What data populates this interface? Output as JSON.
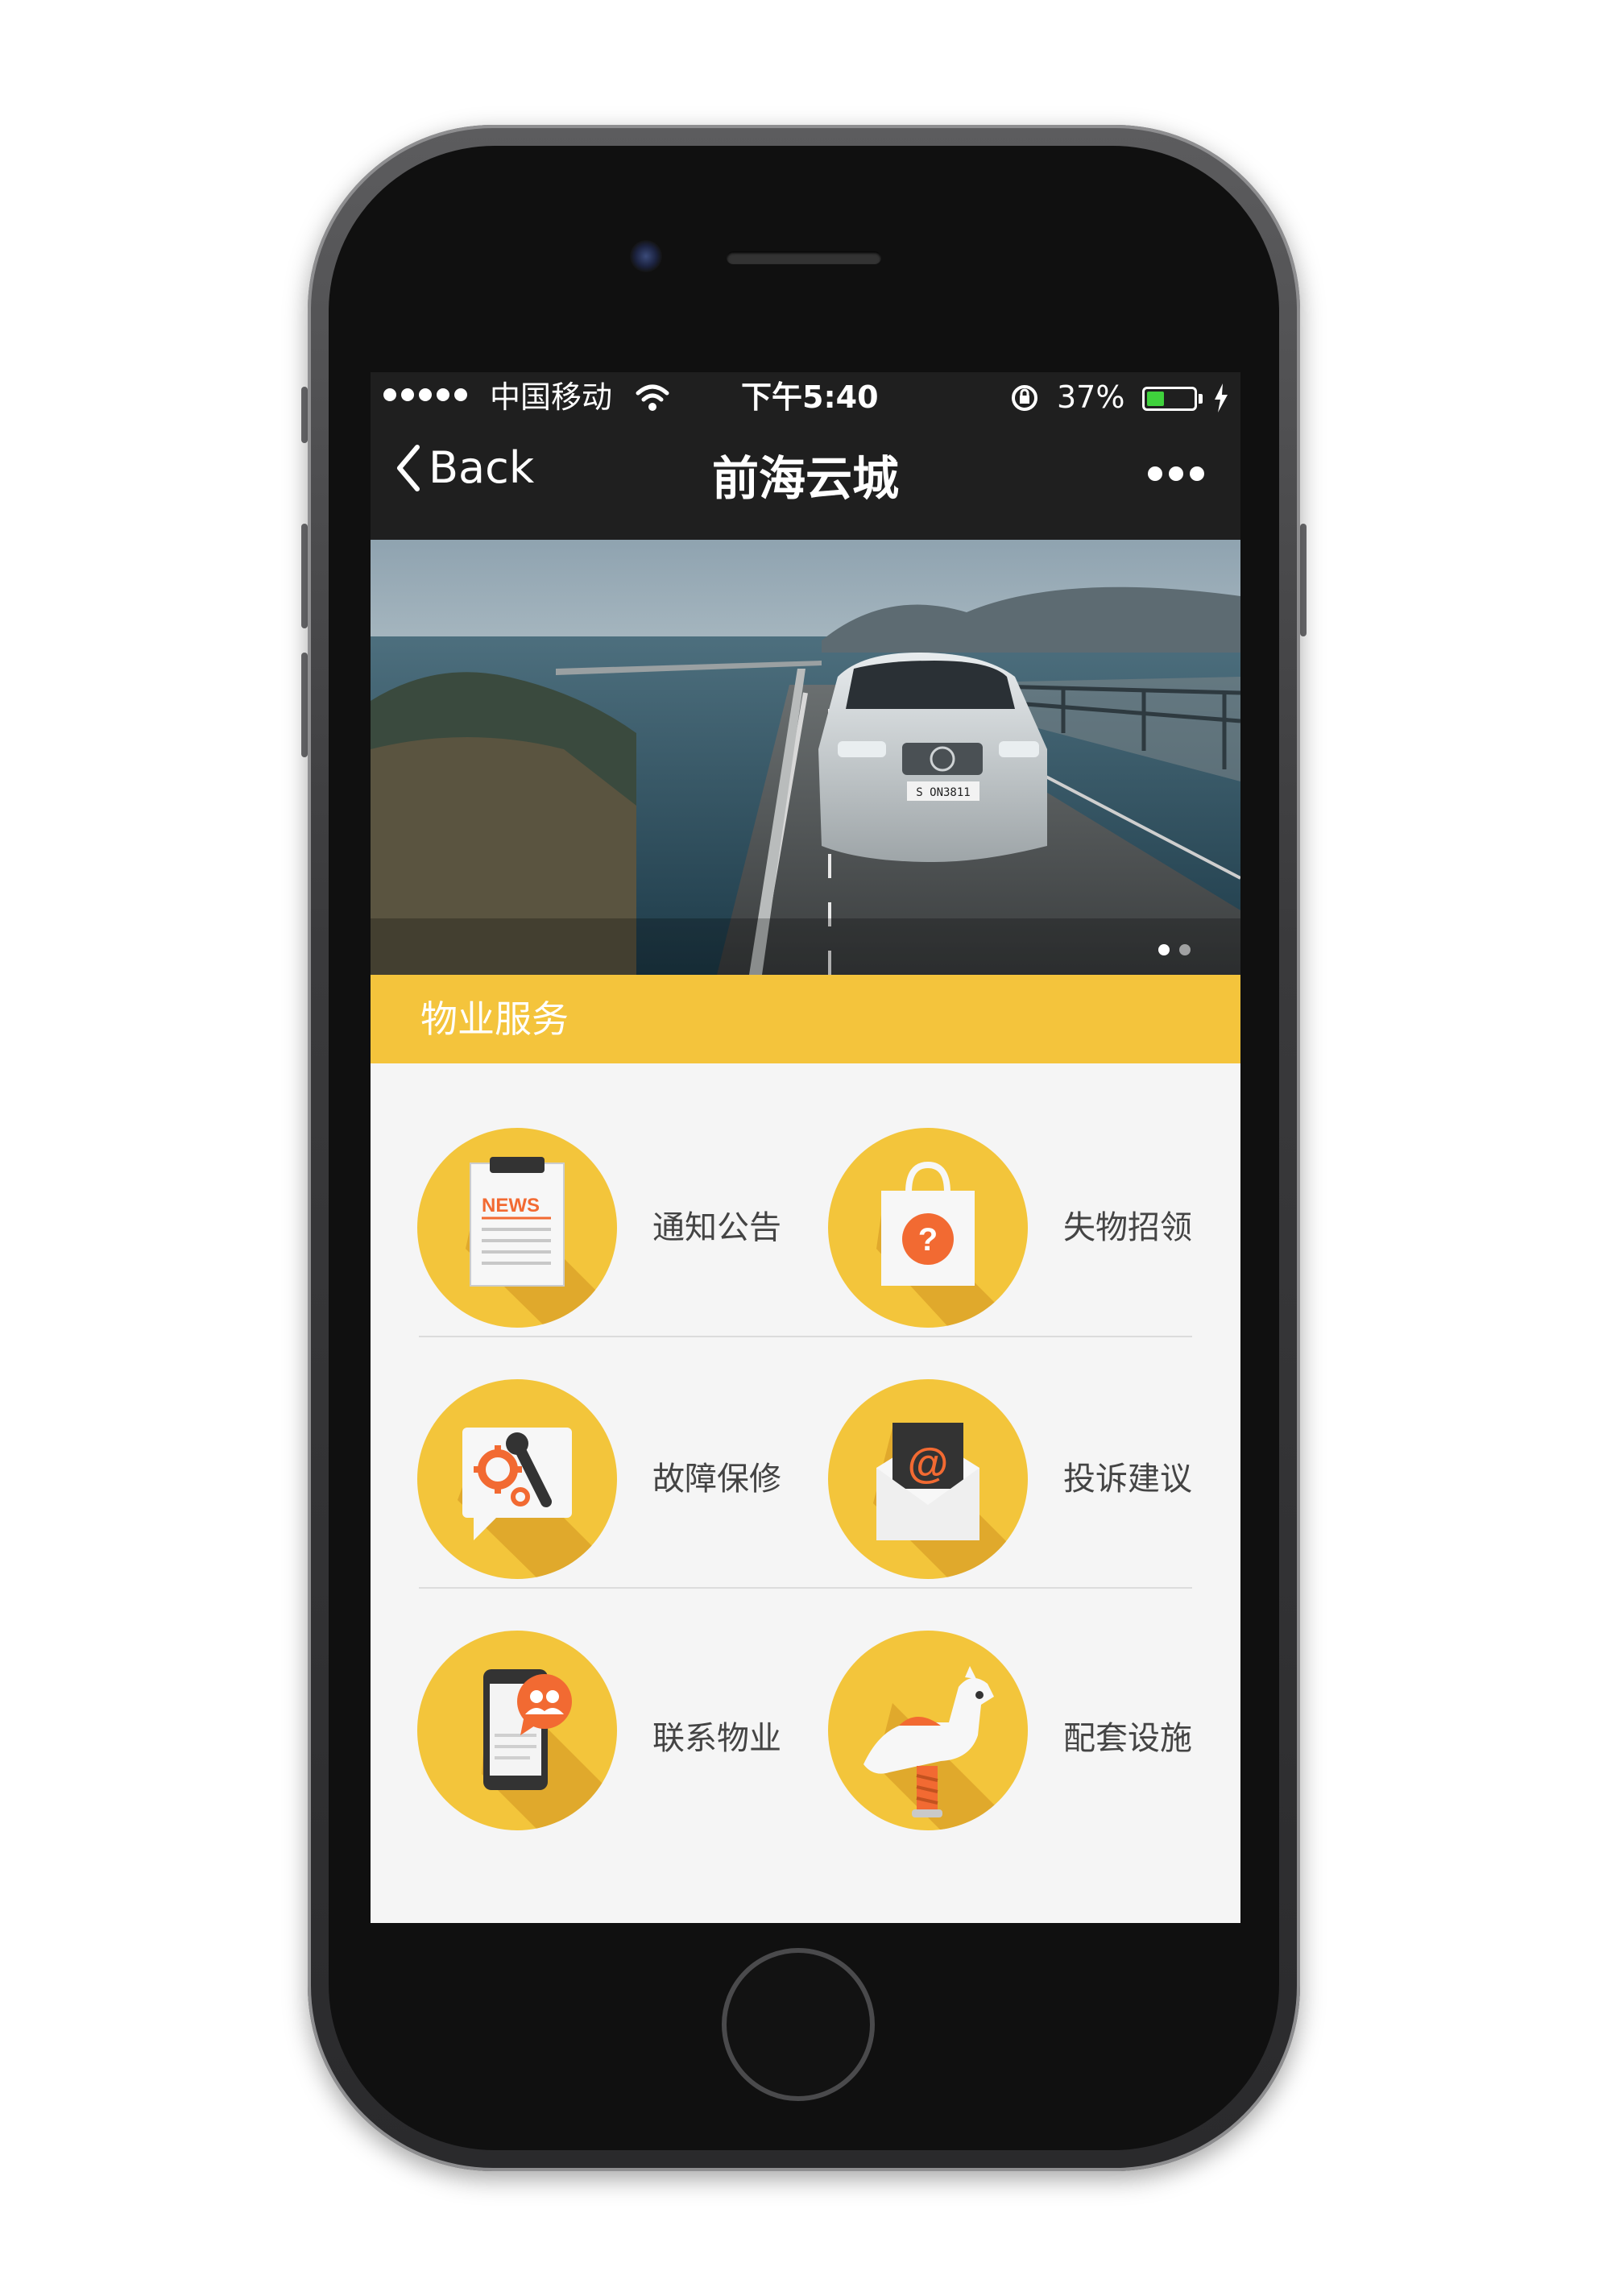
{
  "status_bar": {
    "carrier": "中国移动",
    "time": "下午5:40",
    "battery_percent": "37%",
    "battery_level": 0.37,
    "signal_bars": 5
  },
  "nav": {
    "back_label": "Back",
    "title": "前海云城"
  },
  "banner": {
    "description_icon": "car-on-coastal-bridge-photo",
    "page_count": 2,
    "active_page": 1
  },
  "section": {
    "title": "物业服务"
  },
  "services": [
    {
      "label": "通知公告",
      "icon": "news-clipboard-icon"
    },
    {
      "label": "失物招领",
      "icon": "question-bag-icon"
    },
    {
      "label": "故障保修",
      "icon": "gear-wrench-icon"
    },
    {
      "label": "投诉建议",
      "icon": "at-envelope-icon"
    },
    {
      "label": "联系物业",
      "icon": "phone-contacts-icon"
    },
    {
      "label": "配套设施",
      "icon": "rocking-horse-icon"
    }
  ],
  "icon_texts": {
    "news": "NEWS",
    "question": "?",
    "at": "@",
    "plate": "S ON3811"
  },
  "colors": {
    "accent": "#f4c43c",
    "icon_bg": "#f3c53b",
    "icon_shadow": "#e0a92c",
    "orange": "#f26a32",
    "bar": "#1f1f1f"
  }
}
